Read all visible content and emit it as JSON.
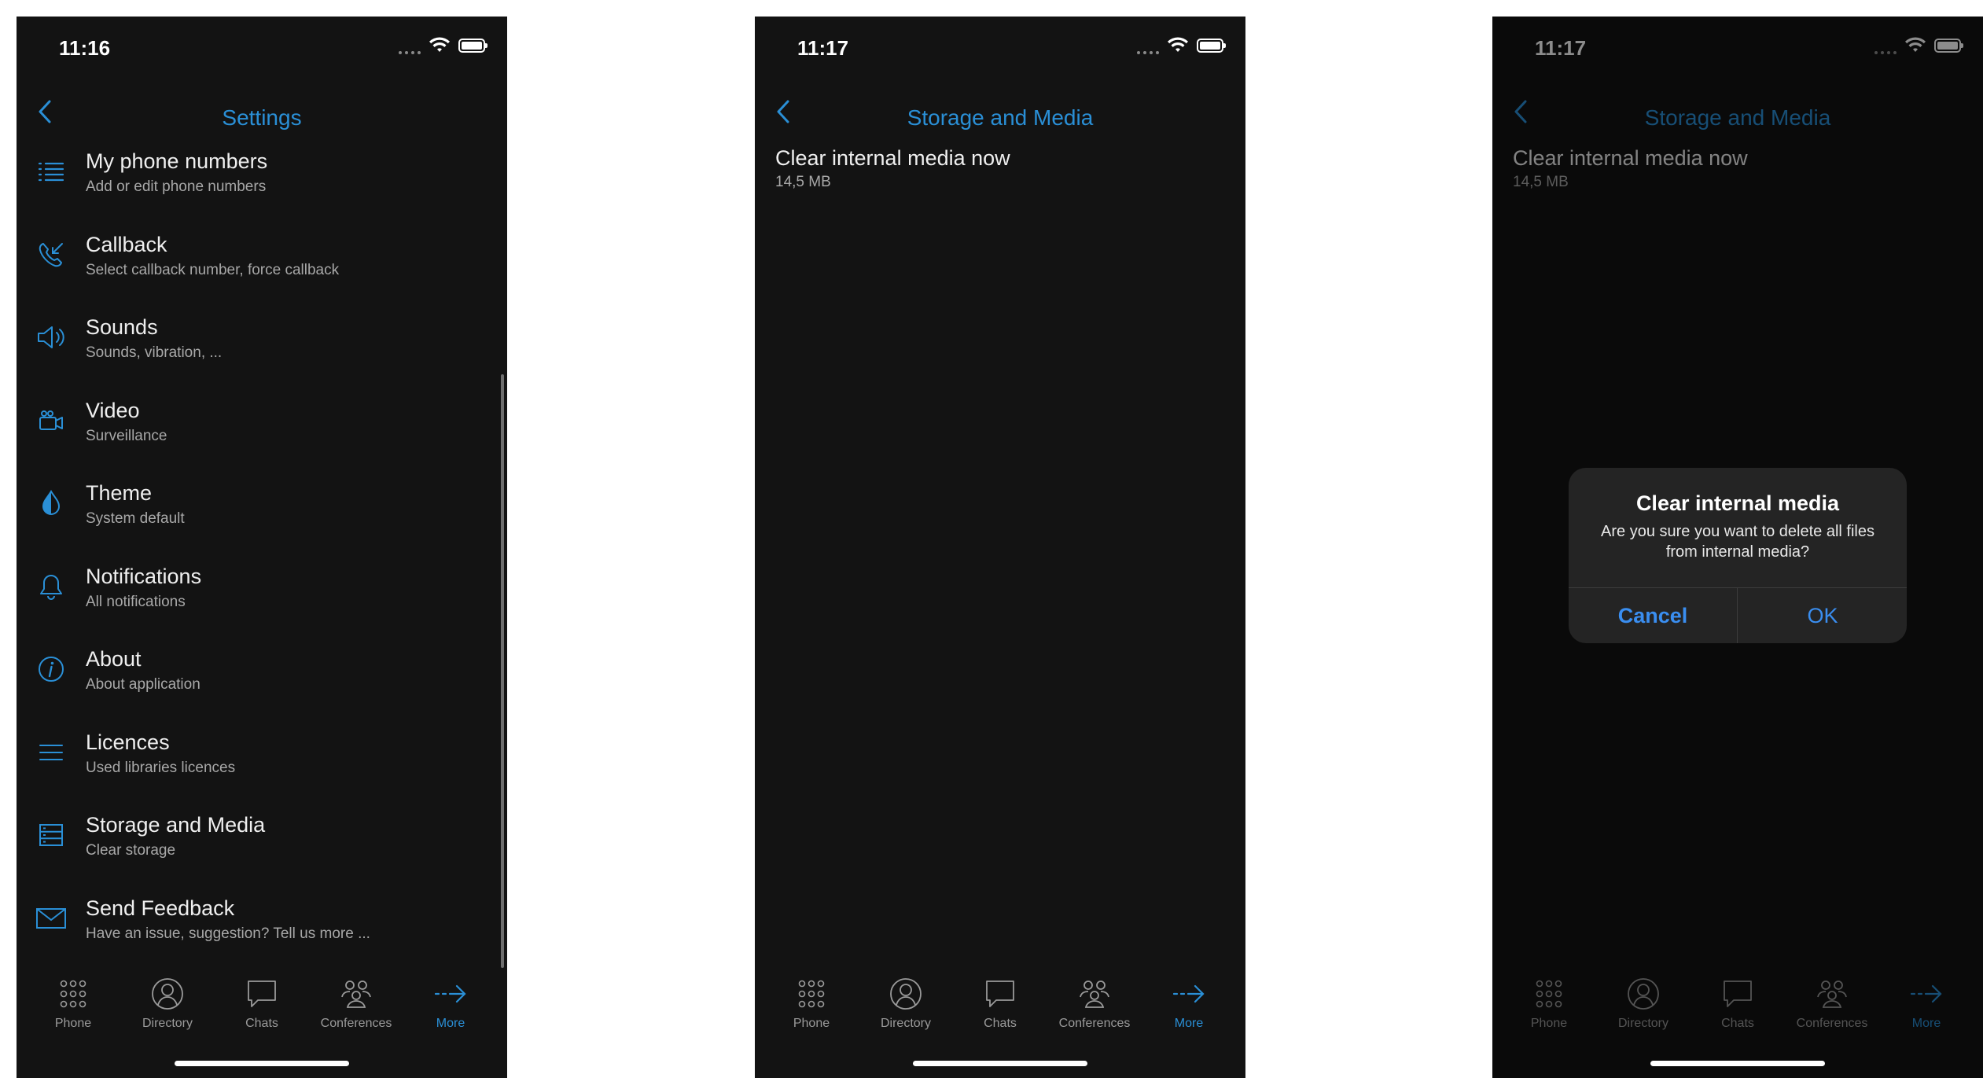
{
  "colors": {
    "accent": "#2a8fd6",
    "background": "#131313",
    "dialog_button": "#3a8ef0"
  },
  "screens": [
    {
      "status_time": "11:16",
      "nav_title": "Settings",
      "items": [
        {
          "icon": "list-icon",
          "title": "My phone numbers",
          "subtitle": "Add or edit phone numbers"
        },
        {
          "icon": "callback-icon",
          "title": "Callback",
          "subtitle": "Select callback number, force callback"
        },
        {
          "icon": "speaker-icon",
          "title": "Sounds",
          "subtitle": "Sounds, vibration, ..."
        },
        {
          "icon": "video-camera-icon",
          "title": "Video",
          "subtitle": "Surveillance"
        },
        {
          "icon": "drop-icon",
          "title": "Theme",
          "subtitle": "System default"
        },
        {
          "icon": "bell-icon",
          "title": "Notifications",
          "subtitle": "All notifications"
        },
        {
          "icon": "info-icon",
          "title": "About",
          "subtitle": "About application"
        },
        {
          "icon": "menu-lines-icon",
          "title": "Licences",
          "subtitle": "Used libraries licences"
        },
        {
          "icon": "storage-icon",
          "title": "Storage and Media",
          "subtitle": "Clear storage"
        },
        {
          "icon": "envelope-icon",
          "title": "Send Feedback",
          "subtitle": "Have an issue, suggestion? Tell us more ..."
        }
      ]
    },
    {
      "status_time": "11:17",
      "nav_title": "Storage and Media",
      "item": {
        "title": "Clear internal media now",
        "subtitle": "14,5 MB"
      }
    },
    {
      "status_time": "11:17",
      "nav_title": "Storage and Media",
      "item": {
        "title": "Clear internal media now",
        "subtitle": "14,5 MB"
      },
      "dialog": {
        "title": "Clear internal media",
        "message": "Are you sure you want to delete all files from internal media?",
        "cancel_label": "Cancel",
        "ok_label": "OK"
      }
    }
  ],
  "tabs": [
    {
      "icon": "dialpad-icon",
      "label": "Phone"
    },
    {
      "icon": "person-icon",
      "label": "Directory"
    },
    {
      "icon": "chat-bubble-icon",
      "label": "Chats"
    },
    {
      "icon": "group-icon",
      "label": "Conferences"
    },
    {
      "icon": "arrow-right-icon",
      "label": "More"
    }
  ]
}
